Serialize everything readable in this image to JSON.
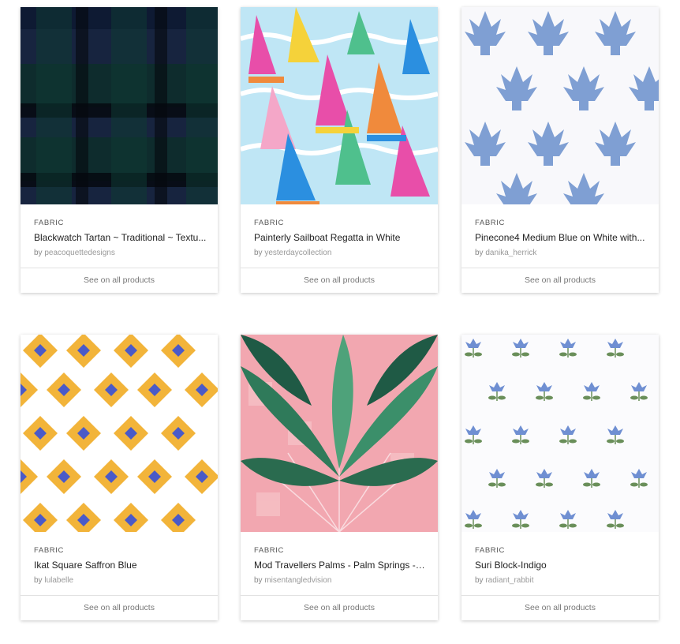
{
  "cards": [
    {
      "category": "FABRIC",
      "title": "Blackwatch Tartan ~ Traditional ~ Textu...",
      "by_prefix": "by",
      "designer": "peacoquettedesigns",
      "cta": "See on all products",
      "pattern": "tartan"
    },
    {
      "category": "FABRIC",
      "title": "Painterly Sailboat Regatta in White",
      "by_prefix": "by",
      "designer": "yesterdaycollection",
      "cta": "See on all products",
      "pattern": "sailboats"
    },
    {
      "category": "FABRIC",
      "title": "Pinecone4 Medium Blue on White with...",
      "by_prefix": "by",
      "designer": "danika_herrick",
      "cta": "See on all products",
      "pattern": "pinecone"
    },
    {
      "category": "FABRIC",
      "title": "Ikat Square Saffron Blue",
      "by_prefix": "by",
      "designer": "lulabelle",
      "cta": "See on all products",
      "pattern": "ikat"
    },
    {
      "category": "FABRIC",
      "title": "Mod Travellers Palms - Palm Springs - g...",
      "by_prefix": "by",
      "designer": "misentangledvision",
      "cta": "See on all products",
      "pattern": "palms"
    },
    {
      "category": "FABRIC",
      "title": "Suri Block-Indigo",
      "by_prefix": "by",
      "designer": "radiant_rabbit",
      "cta": "See on all products",
      "pattern": "floral"
    }
  ],
  "colors": {
    "tartan": [
      "#0f1a33",
      "#17394a",
      "#0a2a26"
    ],
    "sail": [
      "#e84ea9",
      "#f5d23a",
      "#2b8fe0",
      "#4fc08d",
      "#f08a3c",
      "#f4a7c8"
    ],
    "pinecone": "#7f9fd3",
    "ikat": {
      "gold": "#f2b43a",
      "blue": "#4a5ac8"
    },
    "palms": {
      "bg": "#f2a7b0",
      "leaf": "#2f7a5a"
    },
    "floral": {
      "flower": "#6f8fd2",
      "leaf": "#6a8f5a"
    }
  }
}
